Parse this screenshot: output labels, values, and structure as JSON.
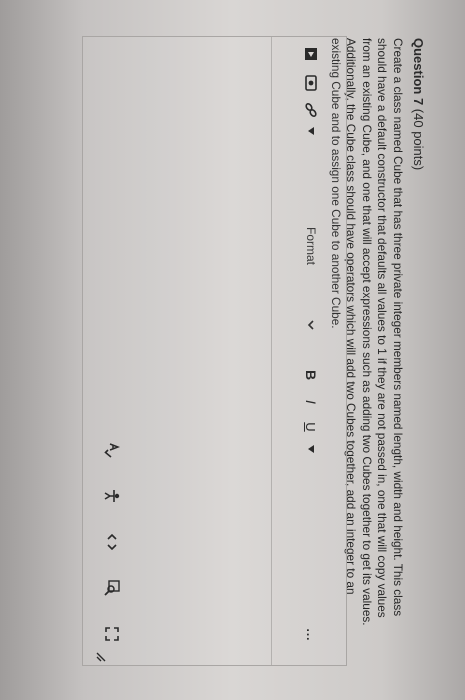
{
  "question": {
    "label": "Question 7",
    "points": " (40 points)",
    "text": "Create a class named Cube that has three private integer members named length, width and height. This class should have a default constructor that defaults all values to 1 if they are not passed in, one that will copy values from an existing Cube, and one that will accept expressions such as adding two Cubes together to get its values. Additionally, the Cube class should have operators which will add two Cubes together, add an integer to an existing Cube and to assign one Cube to another Cube."
  },
  "editor": {
    "format_label": "Format",
    "bold_label": "B",
    "italic_label": "I",
    "underline_label": "U",
    "more_label": "..."
  },
  "colors": {
    "background": "#d9d6d4",
    "text": "#262626",
    "border": "#a9a6a4"
  },
  "icons": [
    "flag-icon",
    "embed-icon",
    "link-icon",
    "dropdown-arrow-icon",
    "chevron-down-icon",
    "spellcheck-icon",
    "accessibility-icon",
    "source-code-icon",
    "find-replace-icon",
    "fullscreen-icon",
    "resize-handle-icon"
  ]
}
